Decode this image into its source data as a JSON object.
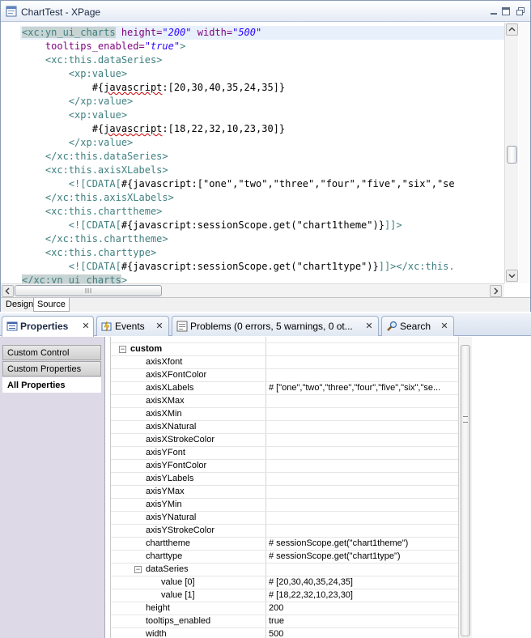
{
  "editor": {
    "title": "ChartTest - XPage",
    "bottom_tabs": [
      "Design",
      "Source"
    ],
    "code_lines": [
      [
        [
          "hl-tag tag",
          "<xc:yn_ui_charts"
        ],
        [
          "attr",
          " height="
        ],
        [
          "val",
          "\"200\""
        ],
        [
          "attr",
          " width="
        ],
        [
          "val",
          "\"500\""
        ]
      ],
      [
        [
          "attr",
          "    tooltips_enabled="
        ],
        [
          "val",
          "\"true\""
        ],
        [
          "tag",
          ">"
        ]
      ],
      [
        [
          "tag",
          "    <xc:this.dataSeries>"
        ]
      ],
      [
        [
          "tag",
          "        <xp:value>"
        ]
      ],
      [
        [
          "txt",
          "            #{"
        ],
        [
          "txt squig",
          "javascript"
        ],
        [
          "txt",
          ":[20,30,40,35,24,35]}"
        ]
      ],
      [
        [
          "tag",
          "        </xp:value>"
        ]
      ],
      [
        [
          "tag",
          "        <xp:value>"
        ]
      ],
      [
        [
          "txt",
          "            #{"
        ],
        [
          "txt squig",
          "javascript"
        ],
        [
          "txt",
          ":[18,22,32,10,23,30]}"
        ]
      ],
      [
        [
          "tag",
          "        </xp:value>"
        ]
      ],
      [
        [
          "tag",
          "    </xc:this.dataSeries>"
        ]
      ],
      [
        [
          "tag",
          "    <xc:this.axisXLabels>"
        ]
      ],
      [
        [
          "tag",
          "        <![CDATA["
        ],
        [
          "txt",
          "#{javascript:[\"one\",\"two\",\"three\",\"four\",\"five\",\"six\",\"se"
        ]
      ],
      [
        [
          "tag",
          "    </xc:this.axisXLabels>"
        ]
      ],
      [
        [
          "tag",
          "    <xc:this.charttheme>"
        ]
      ],
      [
        [
          "tag",
          "        <![CDATA["
        ],
        [
          "txt",
          "#{javascript:sessionScope.get(\"chart1theme\")}"
        ],
        [
          "tag",
          "]]>"
        ]
      ],
      [
        [
          "tag",
          "    </xc:this.charttheme>"
        ]
      ],
      [
        [
          "tag",
          "    <xc:this.charttype>"
        ]
      ],
      [
        [
          "tag",
          "        <![CDATA["
        ],
        [
          "txt",
          "#{javascript:sessionScope.get(\"chart1type\")}"
        ],
        [
          "tag",
          "]]></xc:this."
        ]
      ],
      [
        [
          "hl-tag tag",
          "</xc:yn_ui_charts"
        ],
        [
          "tag",
          ">"
        ]
      ]
    ]
  },
  "views": {
    "tabs": [
      {
        "label": "Properties",
        "active": true,
        "icon": "properties-icon"
      },
      {
        "label": "Events",
        "active": false,
        "icon": "events-icon"
      },
      {
        "label": "Problems (0 errors, 5 warnings, 0 ot...",
        "active": false,
        "icon": "problems-icon"
      },
      {
        "label": "Search",
        "active": false,
        "icon": "search-icon"
      }
    ],
    "close_glyph": "✕"
  },
  "properties": {
    "categories": [
      "Custom Control",
      "Custom Properties",
      "All Properties"
    ],
    "group_label": "custom",
    "rows": [
      {
        "name": "axisXfont",
        "value": ""
      },
      {
        "name": "axisXFontColor",
        "value": ""
      },
      {
        "name": "axisXLabels",
        "value": "# [\"one\",\"two\",\"three\",\"four\",\"five\",\"six\",\"se..."
      },
      {
        "name": "axisXMax",
        "value": ""
      },
      {
        "name": "axisXMin",
        "value": ""
      },
      {
        "name": "axisXNatural",
        "value": ""
      },
      {
        "name": "axisXStrokeColor",
        "value": ""
      },
      {
        "name": "axisYFont",
        "value": ""
      },
      {
        "name": "axisYFontColor",
        "value": ""
      },
      {
        "name": "axisYLabels",
        "value": ""
      },
      {
        "name": "axisYMax",
        "value": ""
      },
      {
        "name": "axisYMin",
        "value": ""
      },
      {
        "name": "axisYNatural",
        "value": ""
      },
      {
        "name": "axisYStrokeColor",
        "value": ""
      },
      {
        "name": "charttheme",
        "value": "# sessionScope.get(\"chart1theme\")"
      },
      {
        "name": "charttype",
        "value": "# sessionScope.get(\"chart1type\")"
      }
    ],
    "dataSeries": {
      "label": "dataSeries",
      "children": [
        {
          "name": "value [0]",
          "value": "# [20,30,40,35,24,35]"
        },
        {
          "name": "value [1]",
          "value": "# [18,22,32,10,23,30]"
        }
      ]
    },
    "tail_rows": [
      {
        "name": "height",
        "value": "200"
      },
      {
        "name": "tooltips_enabled",
        "value": "true"
      },
      {
        "name": "width",
        "value": "500"
      }
    ]
  },
  "colors": {
    "tag": "#3f7f7f",
    "attribute": "#7f007f",
    "attribute_value": "#2a00ff",
    "selection": "#e8f0fb",
    "left_panel": "#ddd9e6"
  }
}
